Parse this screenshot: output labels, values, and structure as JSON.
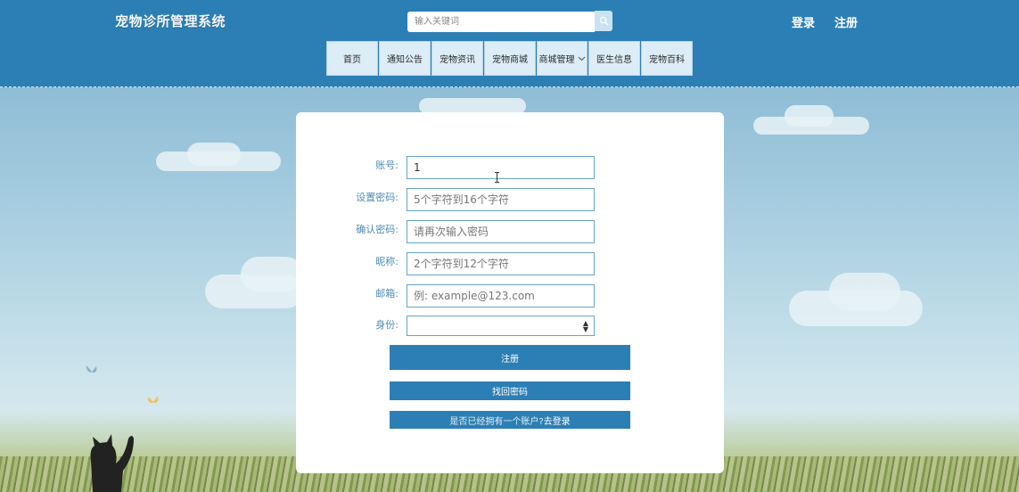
{
  "header": {
    "brand": "宠物诊所管理系统",
    "search_placeholder": "输入关键词",
    "login": "登录",
    "register": "注册"
  },
  "nav": {
    "items": [
      "首页",
      "通知公告",
      "宠物资讯",
      "宠物商城",
      "商城管理",
      "医生信息",
      "宠物百科"
    ]
  },
  "form": {
    "account": {
      "label": "账号:",
      "value": "1"
    },
    "password": {
      "label": "设置密码:",
      "placeholder": "5个字符到16个字符"
    },
    "confirm": {
      "label": "确认密码:",
      "placeholder": "请再次输入密码"
    },
    "nickname": {
      "label": "昵称:",
      "placeholder": "2个字符到12个字符"
    },
    "email": {
      "label": "邮箱:",
      "placeholder": "例: example@123.com"
    },
    "role": {
      "label": "身份:",
      "value": ""
    },
    "register_button": "注册",
    "forgot_button": "找回密码",
    "login_prompt": "是否已经拥有一个账户?",
    "login_link": "去登录"
  },
  "colors": {
    "primary": "#2c7fb4",
    "nav_bg": "#dcedf7",
    "label": "#4f8bb1"
  }
}
